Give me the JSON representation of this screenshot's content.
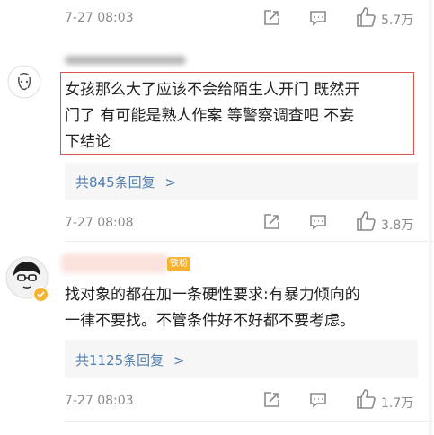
{
  "comments": [
    {
      "time": "7-27 08:03",
      "likes": "5.7万"
    },
    {
      "text_lines": [
        "女孩那么大了应该不会给陌生人开门 既然开",
        "门了 有可能是熟人作案 等警察调查吧 不妄",
        "下结论"
      ],
      "reply_label": "共845条回复",
      "reply_arrow": ">",
      "time": "7-27 08:08",
      "likes": "3.8万"
    },
    {
      "badge": "铁粉",
      "text_lines": [
        "找对象的都在加一条硬性要求:有暴力倾向的",
        "一律不要找。不管条件好不好都不要考虑。"
      ],
      "reply_label": "共1125条回复",
      "reply_arrow": ">",
      "time": "7-27 08:03",
      "likes": "1.7万"
    }
  ],
  "icons": [
    "share-icon",
    "comment-icon",
    "like-icon",
    "verified-badge-icon"
  ],
  "colors": {
    "highlight_border": "#d9534f",
    "reply_link": "#507daf",
    "badge_bg": "#f7b234"
  }
}
